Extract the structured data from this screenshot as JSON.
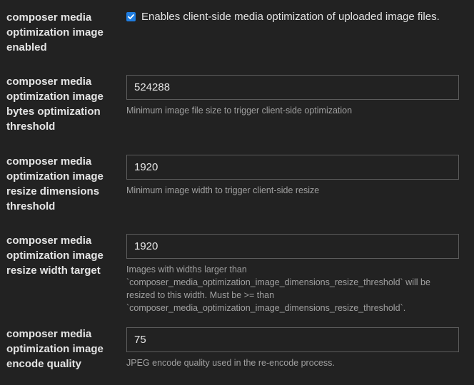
{
  "settings": [
    {
      "label": "composer media\noptimization image\nenabled",
      "checkbox_label": "Enables client-side media optimization of uploaded image files.",
      "checked": true
    },
    {
      "label": "composer media\noptimization image\nbytes optimization\nthreshold",
      "value": "524288",
      "description": "Minimum image file size to trigger client-side optimization"
    },
    {
      "label": "composer media\noptimization image\nresize dimensions\nthreshold",
      "value": "1920",
      "description": "Minimum image width to trigger client-side resize"
    },
    {
      "label": "composer media\noptimization image\nresize width target",
      "value": "1920",
      "description": "Images with widths larger than\n`composer_media_optimization_image_dimensions_resize_threshold` will be\nresized to this width. Must be >= than\n`composer_media_optimization_image_dimensions_resize_threshold`."
    },
    {
      "label": "composer media\noptimization image\nencode quality",
      "value": "75",
      "description": "JPEG encode quality used in the re-encode process."
    }
  ],
  "colors": {
    "background": "#222222",
    "checkbox": "#1f7de0",
    "input_border": "#5c5c5c",
    "description_text": "#a0a0a0"
  }
}
